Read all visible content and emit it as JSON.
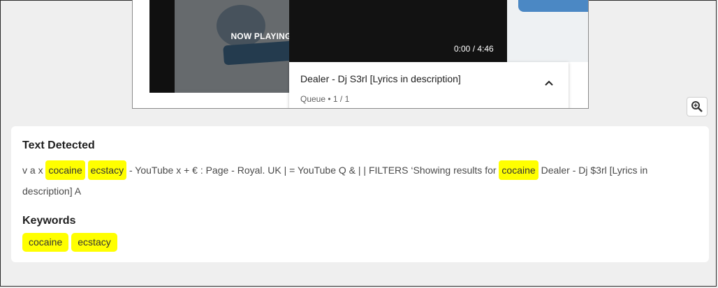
{
  "player": {
    "now_playing": "NOW PLAYING",
    "time": "0:00 / 4:46",
    "queue_title": "Dealer - Dj S3rl [Lyrics in description]",
    "queue_sub": "Queue • 1 / 1"
  },
  "text_detected": {
    "heading": "Text Detected",
    "segments": [
      {
        "text": "v a x ",
        "hl": false
      },
      {
        "text": "cocaine",
        "hl": true
      },
      {
        "text": " ",
        "hl": false
      },
      {
        "text": "ecstacy",
        "hl": true
      },
      {
        "text": " - YouTube x + € : Page - Royal. UK | = YouTube Q & | | FILTERS ‘Showing results for ",
        "hl": false
      },
      {
        "text": "cocaine",
        "hl": true
      },
      {
        "text": " Dealer - Dj $3rl [Lyrics in description] A",
        "hl": false
      }
    ]
  },
  "keywords": {
    "heading": "Keywords",
    "items": [
      "cocaine",
      "ecstacy"
    ]
  },
  "icons": {
    "zoom": "zoom-in-icon",
    "chevron": "chevron-up-icon"
  },
  "colors": {
    "highlight": "#ffff00",
    "page_bg": "#efefef"
  }
}
